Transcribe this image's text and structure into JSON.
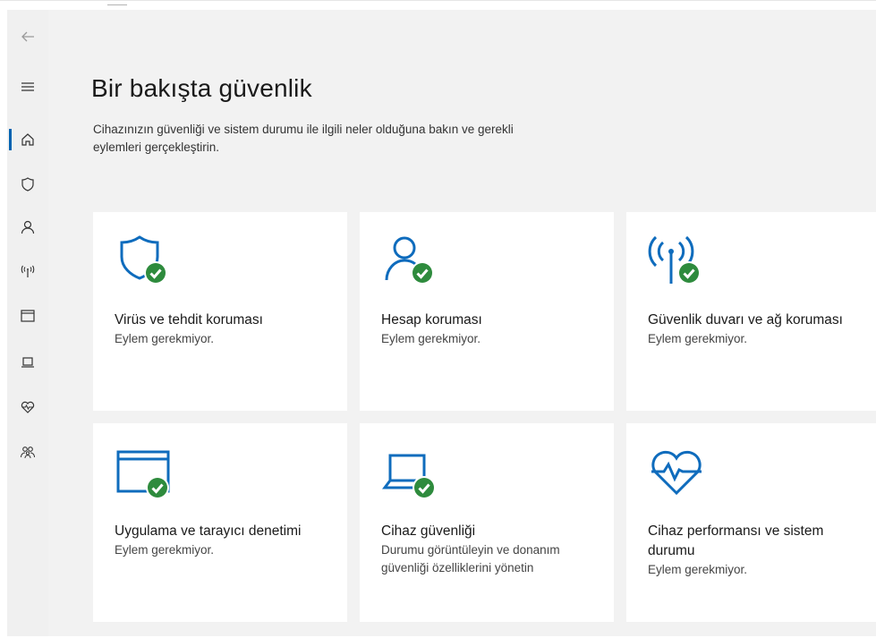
{
  "header": {
    "title": "Bir bakışta güvenlik",
    "description": "Cihazınızın güvenliği ve sistem durumu ile ilgili neler olduğuna bakın ve gerekli eylemleri gerçekleştirin."
  },
  "colors": {
    "accent": "#0063b1",
    "icon_blue": "#0f6cbd",
    "ok_green": "#2e8b3d"
  },
  "sidebar": {
    "items": [
      {
        "name": "back",
        "icon": "back-arrow-icon"
      },
      {
        "name": "menu",
        "icon": "hamburger-menu-icon"
      },
      {
        "name": "home",
        "icon": "home-icon",
        "active": true
      },
      {
        "name": "virus-protection",
        "icon": "shield-icon"
      },
      {
        "name": "account-protection",
        "icon": "person-icon"
      },
      {
        "name": "firewall",
        "icon": "network-antenna-icon"
      },
      {
        "name": "app-browser",
        "icon": "browser-window-icon"
      },
      {
        "name": "device-security",
        "icon": "laptop-icon"
      },
      {
        "name": "device-performance",
        "icon": "heart-pulse-icon"
      },
      {
        "name": "family-options",
        "icon": "family-icon"
      }
    ]
  },
  "tiles": [
    {
      "title": "Virüs ve tehdit koruması",
      "subtitle": "Eylem gerekmiyor.",
      "icon": "shield-check-icon"
    },
    {
      "title": "Hesap koruması",
      "subtitle": "Eylem gerekmiyor.",
      "icon": "person-check-icon"
    },
    {
      "title": "Güvenlik duvarı ve ağ koruması",
      "subtitle": "Eylem gerekmiyor.",
      "icon": "antenna-check-icon"
    },
    {
      "title": "Uygulama ve tarayıcı denetimi",
      "subtitle": "Eylem gerekmiyor.",
      "icon": "window-check-icon"
    },
    {
      "title": "Cihaz güvenliği",
      "subtitle": "Durumu görüntüleyin ve donanım güvenliği özelliklerini yönetin",
      "icon": "laptop-check-icon"
    },
    {
      "title": "Cihaz performansı ve sistem durumu",
      "subtitle": "Eylem gerekmiyor.",
      "icon": "heart-pulse-icon"
    }
  ]
}
